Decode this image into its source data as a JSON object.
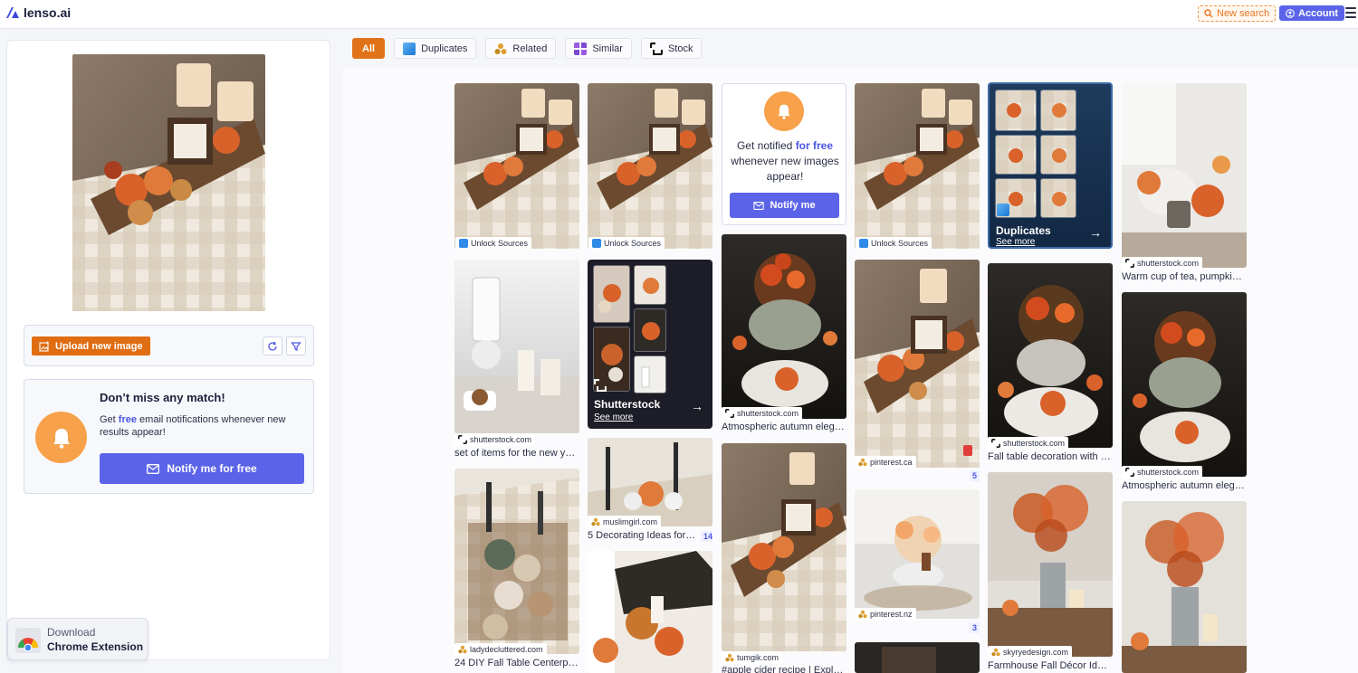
{
  "app": {
    "brand": "lenso.ai"
  },
  "header": {
    "new_search": "New search",
    "account": "Account"
  },
  "upload": {
    "label": "Upload new image"
  },
  "left_notify": {
    "title": "Don’t miss any match!",
    "text_before": "Get ",
    "free": "free",
    "text_after": " email notifications whenever new results appear!",
    "button": "Notify me for free"
  },
  "chrome_extension": {
    "line1": "Download",
    "line2": "Chrome Extension"
  },
  "filters": [
    {
      "label": "All",
      "active": true
    },
    {
      "label": "Duplicates",
      "icon": "duplicates-icon"
    },
    {
      "label": "Related",
      "icon": "related-icon"
    },
    {
      "label": "Similar",
      "icon": "similar-icon"
    },
    {
      "label": "Stock",
      "icon": "stock-icon"
    }
  ],
  "notify_tile": {
    "line_before": "Get notified ",
    "free": "for free",
    "line_after": " whenever new images appear!",
    "button": "Notify me"
  },
  "promos": {
    "duplicates": {
      "title": "Duplicates",
      "link": "See more"
    },
    "shutterstock": {
      "title": "Shutterstock",
      "link": "See more"
    }
  },
  "results": {
    "r1": {
      "source": "Unlock Sources"
    },
    "r2": {
      "source": "Unlock Sources"
    },
    "r3": {
      "source": "Unlock Sources"
    },
    "r4": {
      "source": "shutterstock.com",
      "caption": "Warm cup of tea, pumpkins..."
    },
    "r5": {
      "source": "shutterstock.com",
      "caption": "set of items for the new yea..."
    },
    "r6": {
      "source": "shutterstock.com",
      "caption": "Atmospheric autumn elega..."
    },
    "r7": {
      "source": "pinterest.ca",
      "count": "5"
    },
    "r8": {
      "source": "shutterstock.com",
      "caption": "Fall table decoration with p..."
    },
    "r9": {
      "source": "shutterstock.com",
      "caption": "Atmospheric autumn elega..."
    },
    "r10": {
      "source": "muslimgirl.com",
      "caption": "5 Decorating Ideas for t...",
      "count": "14"
    },
    "r11": {
      "source": "pinterest.nz",
      "count": "3"
    },
    "r12": {
      "source": "ladydecluttered.com",
      "caption": "24 DIY Fall Table Centerpiec..."
    },
    "r13": {
      "source": "tumgik.com",
      "caption": "#apple cider recipe | Explor..."
    },
    "r14": {
      "source": "skyryedesign.com",
      "caption": "Farmhouse Fall Décor Ideas..."
    }
  }
}
